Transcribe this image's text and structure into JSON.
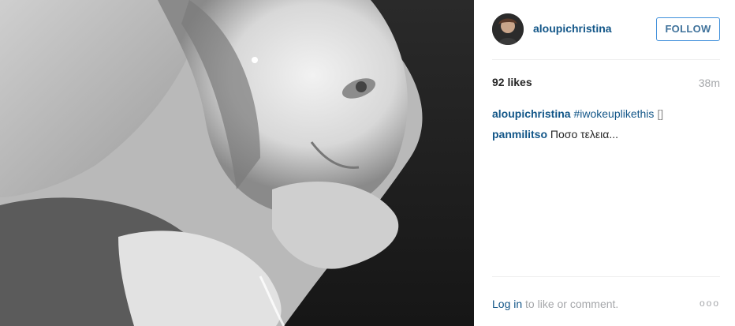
{
  "post": {
    "username": "aloupichristina",
    "follow_label": "FOLLOW",
    "likes": "92 likes",
    "time": "38m",
    "caption": {
      "author": "aloupichristina",
      "hashtag": "#iwokeuplikethis",
      "glyph": "[]"
    },
    "comments": [
      {
        "author": "panmilitso",
        "text": "Ποσο τελεια..."
      }
    ],
    "footer": {
      "login_link": "Log in",
      "login_text": "to like or comment.",
      "more_label": "ooo"
    },
    "icons": {
      "more": "ellipsis-icon"
    },
    "colors": {
      "link": "#125688",
      "follow_border": "#4090db",
      "muted": "#a5a7aa"
    }
  }
}
